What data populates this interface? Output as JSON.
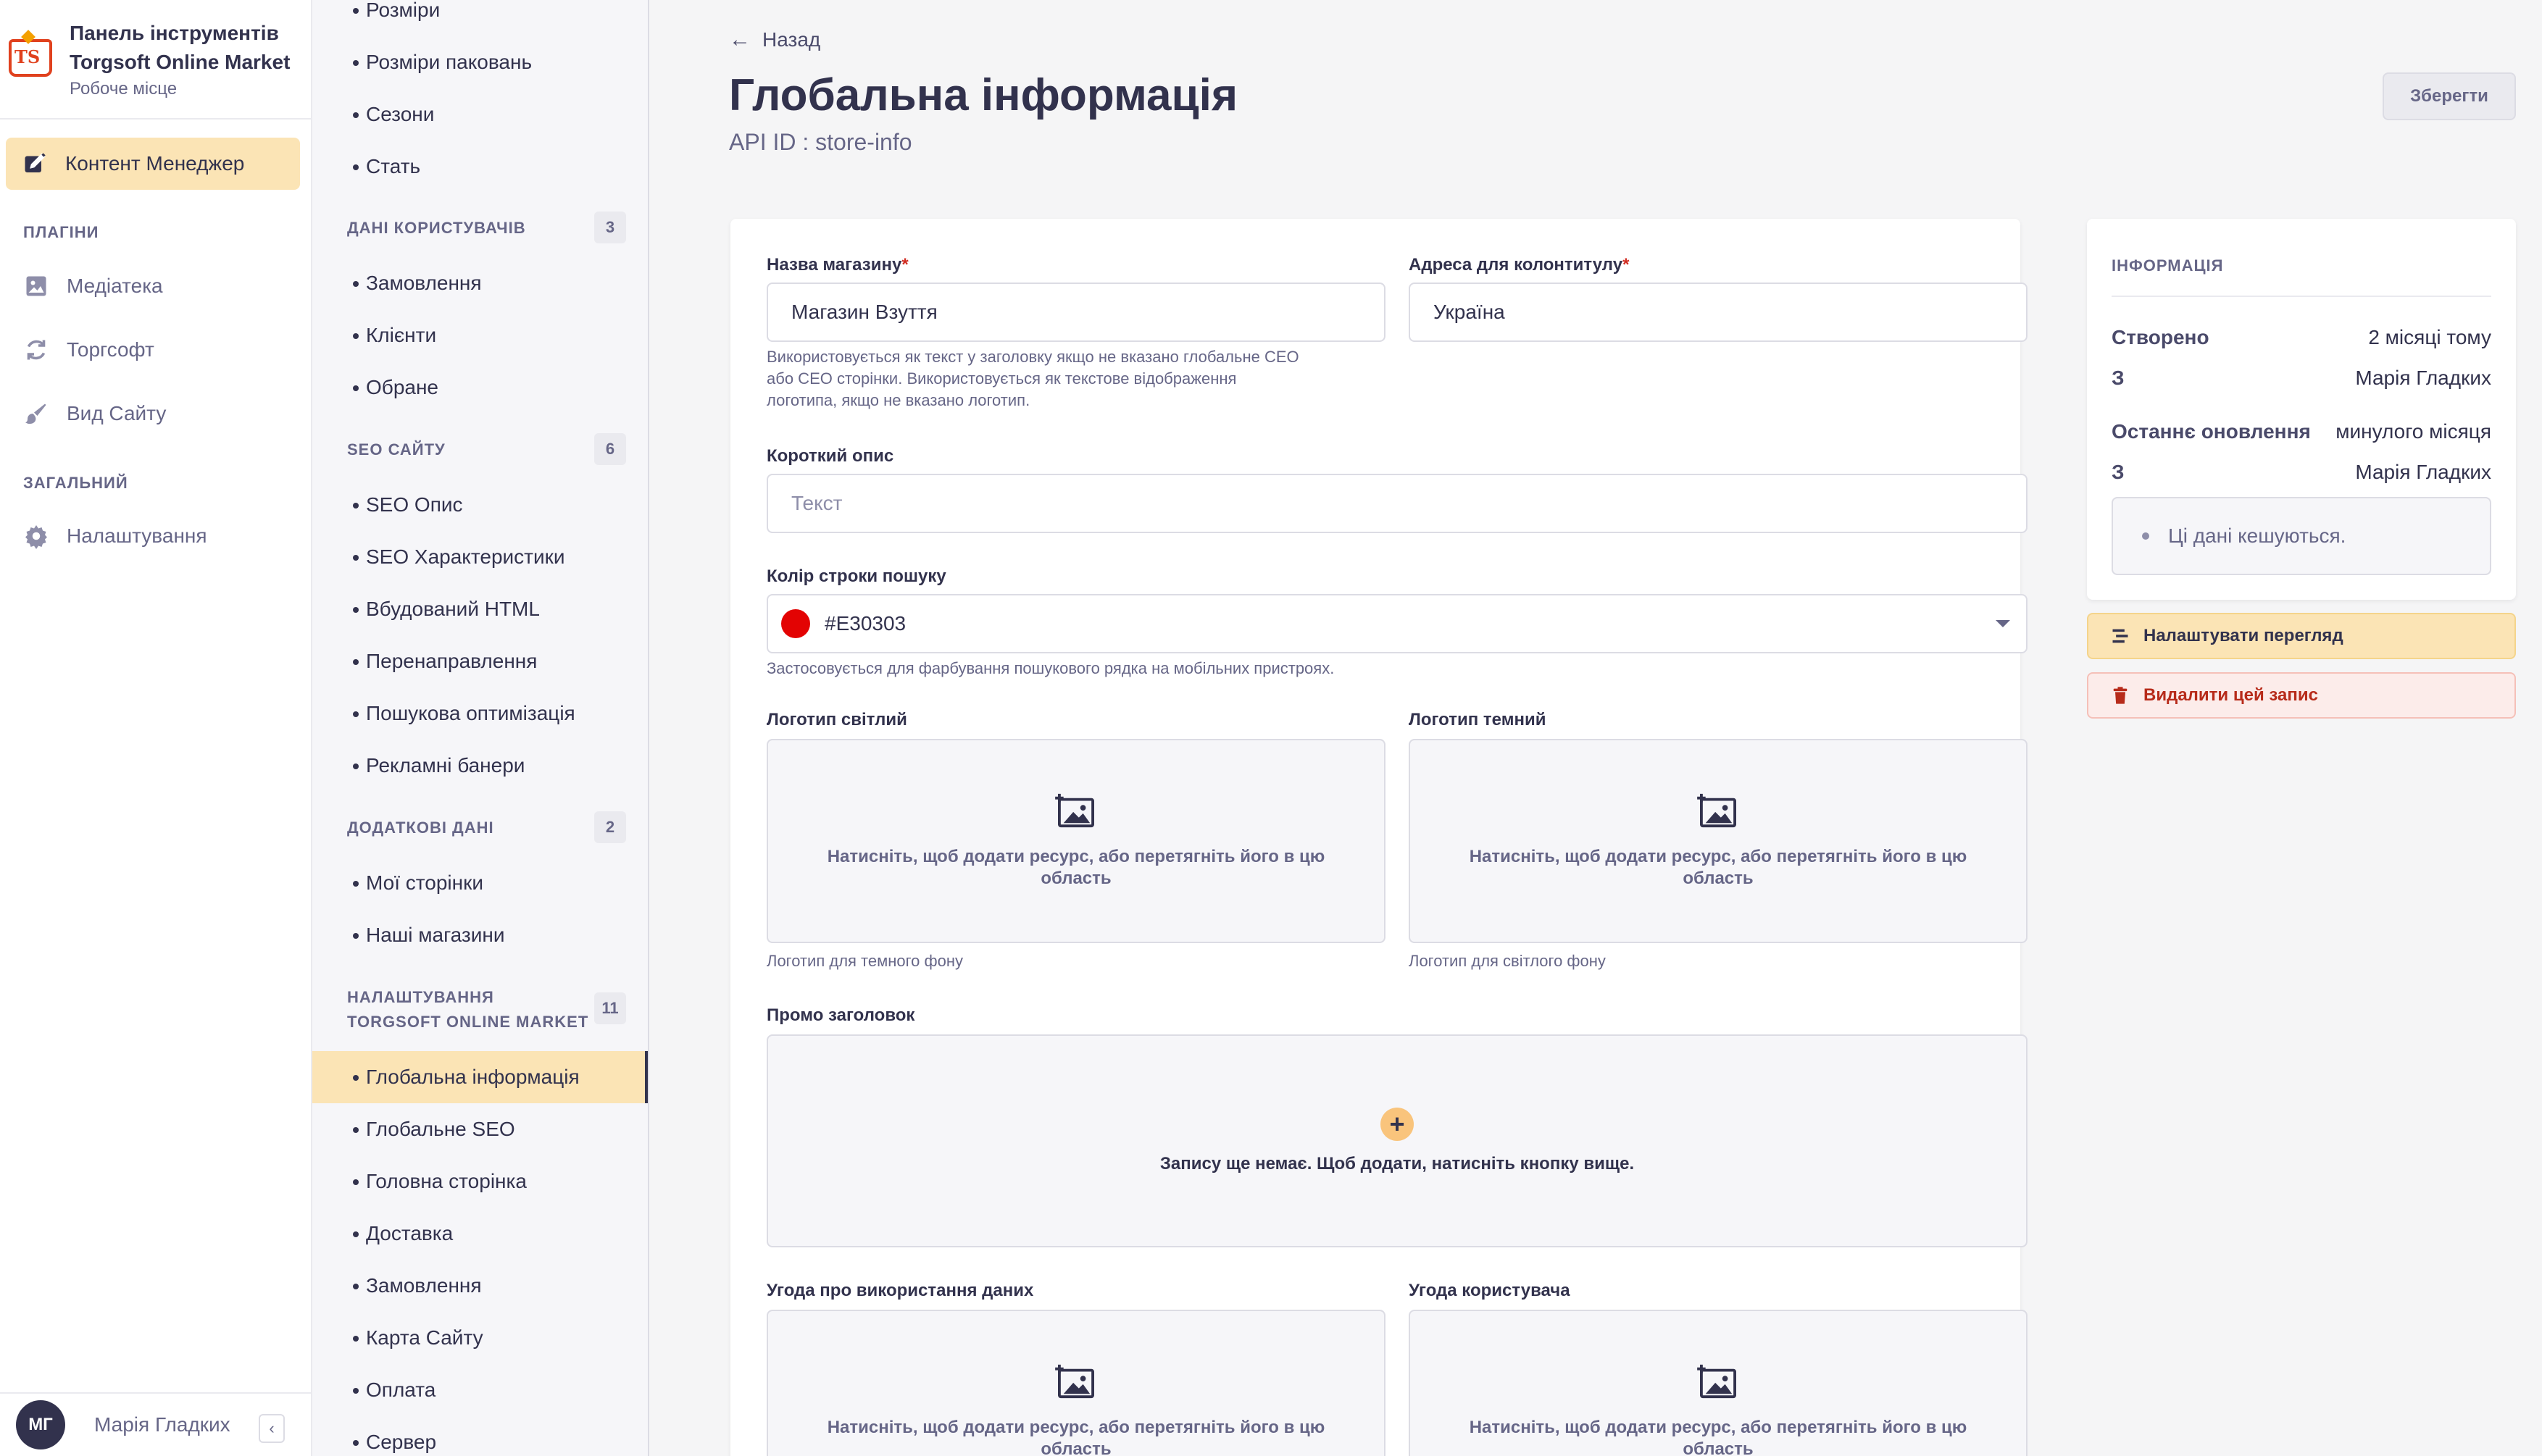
{
  "brand": {
    "title_line1": "Панель інструментів",
    "title_line2": "Torgsoft Online Market",
    "subtitle": "Робоче місце"
  },
  "mainnav": {
    "active_item": "Контент Менеджер",
    "plugins_header": "ПЛАГІНИ",
    "plugins": [
      {
        "label": "Медіатека",
        "icon": "media-icon"
      },
      {
        "label": "Торгсофт",
        "icon": "sync-icon"
      },
      {
        "label": "Вид Сайту",
        "icon": "brush-icon"
      }
    ],
    "general_header": "ЗАГАЛЬНИЙ",
    "general": [
      {
        "label": "Налаштування",
        "icon": "gear-icon"
      }
    ]
  },
  "user": {
    "initials": "МГ",
    "name": "Марія Гладких"
  },
  "subnav": {
    "top_items": [
      "Розміри",
      "Розміри паковань",
      "Сезони",
      "Стать"
    ],
    "groups": [
      {
        "title": "ДАНІ КОРИСТУВАЧІВ",
        "count": "3",
        "items": [
          "Замовлення",
          "Клієнти",
          "Обране"
        ]
      },
      {
        "title": "SEO САЙТУ",
        "count": "6",
        "items": [
          "SEO Опис",
          "SEO Характеристики",
          "Вбудований HTML",
          "Перенаправлення",
          "Пошукова оптимізація",
          "Рекламні банери"
        ]
      },
      {
        "title": "ДОДАТКОВІ ДАНІ",
        "count": "2",
        "items": [
          "Мої сторінки",
          "Наші магазини"
        ]
      },
      {
        "title_line1": "НАЛАШТУВАННЯ",
        "title_line2": "TORGSOFT ONLINE MARKET",
        "count": "11",
        "items": [
          "Глобальна інформація",
          "Глобальне SEO",
          "Головна сторінка",
          "Доставка",
          "Замовлення",
          "Карта Сайту",
          "Оплата",
          "Сервер"
        ]
      }
    ]
  },
  "header": {
    "back": "Назад",
    "title": "Глобальна інформація",
    "api_id": "API ID : store-info",
    "save": "Зберегти"
  },
  "form": {
    "store_name": {
      "label": "Назва магазину",
      "value": "Магазин Взуття",
      "hint_line1": "Використовується як текст у заголовку якщо не вказано глобальне CEO",
      "hint_line2": "або CEO сторінки. Використовується як текстове відображення",
      "hint_line3": "логотипа, якщо не вказано логотип."
    },
    "footer_address": {
      "label": "Адреса для колонтитулу",
      "value": "Україна"
    },
    "short_desc": {
      "label": "Короткий опис",
      "placeholder": "Текст"
    },
    "search_color": {
      "label": "Колір строки пошуку",
      "value": "#E30303",
      "hint": "Застосовується для фарбування пошукового рядка на мобільних пристроях."
    },
    "logo_light": {
      "label": "Логотип світлий",
      "drop_line1": "Натисніть, щоб додати ресурс, або перетягніть його в цю",
      "drop_line2": "область",
      "hint": "Логотип для темного фону"
    },
    "logo_dark": {
      "label": "Логотип темний",
      "drop_line1": "Натисніть, щоб додати ресурс, або перетягніть його в цю",
      "drop_line2": "область",
      "hint": "Логотип для світлого фону"
    },
    "promo": {
      "label": "Промо заголовок",
      "empty": "Запису ще немає. Щоб додати, натисніть кнопку вище."
    },
    "data_agreement": {
      "label": "Угода про використання даних",
      "drop_line1": "Натисніть, щоб додати ресурс, або перетягніть його в цю",
      "drop_line2": "область"
    },
    "user_agreement": {
      "label": "Угода користувача",
      "drop_line1": "Натисніть, щоб додати ресурс, або перетягніть його в цю",
      "drop_line2": "область"
    }
  },
  "info": {
    "header": "ІНФОРМАЦІЯ",
    "created_label": "Створено",
    "created_value": "2 місяці тому",
    "by_label": "З",
    "created_by": "Марія Гладких",
    "updated_label": "Останнє оновлення",
    "updated_value": "минулого місяця",
    "updated_by": "Марія Гладких",
    "cache_note": "Ці дані кешуються."
  },
  "actions": {
    "configure_view": "Налаштувати перегляд",
    "delete": "Видалити цей запис"
  },
  "colors": {
    "accent": "#fbe4b5",
    "search_color": "#E30303",
    "danger": "#b72b1a"
  }
}
